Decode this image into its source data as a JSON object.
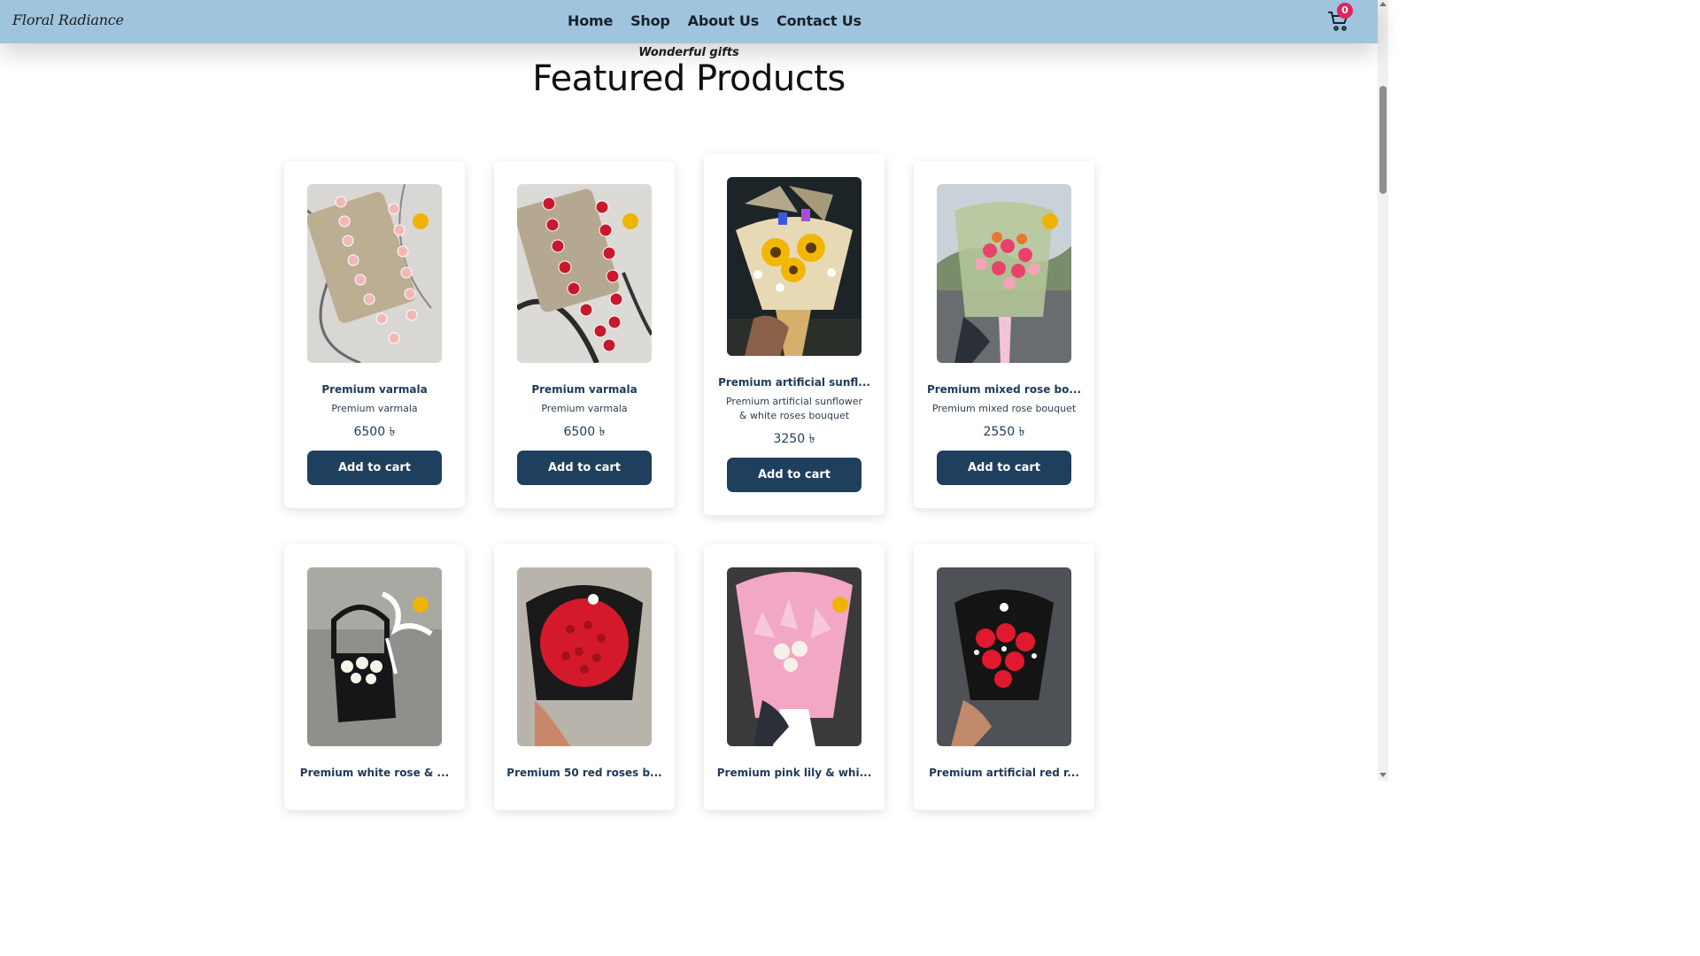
{
  "brand": {
    "logo": "Floral Radiance"
  },
  "nav": {
    "items": [
      "Home",
      "Shop",
      "About Us",
      "Contact Us"
    ]
  },
  "cart": {
    "count": "0"
  },
  "hero": {
    "eyebrow": "Wonderful gifts",
    "title": "Featured Products"
  },
  "products": [
    {
      "title": "Premium varmala",
      "desc": "Premium varmala",
      "price": "6500 ৳",
      "button": "Add to cart",
      "image": "pink-rose-varmala"
    },
    {
      "title": "Premium varmala",
      "desc": "Premium varmala",
      "price": "6500 ৳",
      "button": "Add to cart",
      "image": "red-rose-varmala"
    },
    {
      "title": "Premium artificial sunfl...",
      "desc": "Premium artificial sunflower & white roses bouquet",
      "price": "3250 ৳",
      "button": "Add to cart",
      "image": "sunflower-bouquet"
    },
    {
      "title": "Premium mixed rose bo...",
      "desc": "Premium mixed rose bouquet",
      "price": "2550 ৳",
      "button": "Add to cart",
      "image": "mixed-rose-bouquet"
    },
    {
      "title": "Premium white rose & ...",
      "image": "white-rose-box"
    },
    {
      "title": "Premium 50 red roses b...",
      "image": "red-roses-bouquet"
    },
    {
      "title": "Premium pink lily & whi...",
      "image": "pink-lily-bouquet"
    },
    {
      "title": "Premium artificial red r...",
      "image": "artificial-red-rose-bouquet"
    }
  ],
  "colors": {
    "navbar": "#a0c4de",
    "button": "#1f3f5f",
    "badge": "#e0245e",
    "title_text": "#1e3a5a"
  }
}
